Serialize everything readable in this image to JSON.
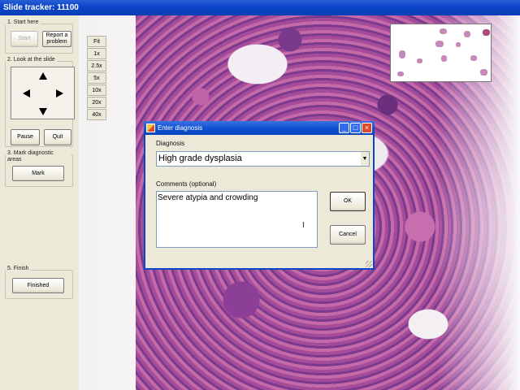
{
  "window": {
    "title": "Slide tracker: 11100"
  },
  "panel": {
    "step1": {
      "title": "1. Start here",
      "start_label": "Start",
      "report_label": "Report a problem"
    },
    "step2": {
      "title": "2. Look at the slide",
      "pause_label": "Pause",
      "quit_label": "Quit"
    },
    "step3": {
      "title": "3. Mark diagnostic areas",
      "mark_label": "Mark"
    },
    "step5": {
      "title": "5. Finish",
      "finished_label": "Finished"
    }
  },
  "zoom": {
    "levels": [
      "Fit",
      "1x",
      "2.5x",
      "5x",
      "10x",
      "20x",
      "40x"
    ]
  },
  "dialog": {
    "title": "Enter diagnosis",
    "diagnosis_label": "Diagnosis",
    "diagnosis_value": "High grade dysplasia",
    "comments_label": "Comments (optional)",
    "comments_value": "Severe atypia and crowding",
    "ok_label": "OK",
    "cancel_label": "Cancel"
  },
  "icons": [
    "up-arrow-icon",
    "down-arrow-icon",
    "left-arrow-icon",
    "right-arrow-icon",
    "minimize-icon",
    "maximize-icon",
    "close-icon",
    "dropdown-arrow-icon",
    "i-beam-cursor-icon"
  ],
  "colors": {
    "titlebar": "#0b46c9",
    "tissue": "#a45599",
    "panel": "#ece9d8",
    "close_button": "#d9492a"
  }
}
